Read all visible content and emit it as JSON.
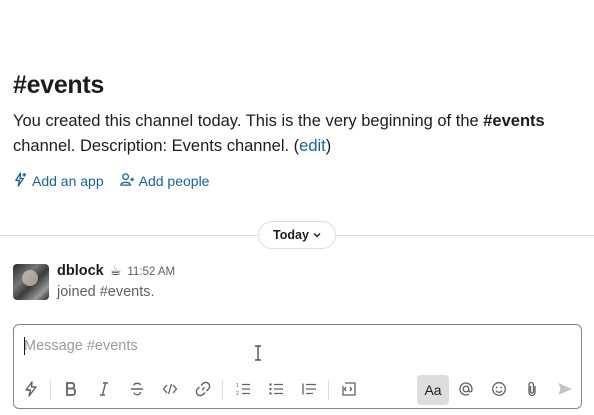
{
  "channel": {
    "hash": "#",
    "name": "events",
    "desc_before": "You created this channel today. This is the very beginning of the ",
    "desc_channel": "#events",
    "desc_after": " channel. Description: Events channel. (",
    "edit_label": "edit",
    "desc_close": ")"
  },
  "actions": {
    "add_app": "Add an app",
    "add_people": "Add people"
  },
  "day_divider": {
    "label": "Today",
    "chevron": "⌄"
  },
  "message": {
    "username": "dblock",
    "status_emoji": "☕",
    "time": "11:52 AM",
    "text": "joined #events."
  },
  "composer": {
    "placeholder": "Message #events",
    "format_label": "Aa"
  },
  "icons": [
    "lightning-icon",
    "bold-icon",
    "italic-icon",
    "strike-icon",
    "code-icon",
    "link-icon",
    "ordered-list-icon",
    "bullet-list-icon",
    "blockquote-icon",
    "code-block-icon",
    "mention-icon",
    "emoji-icon",
    "attach-icon",
    "send-icon"
  ]
}
